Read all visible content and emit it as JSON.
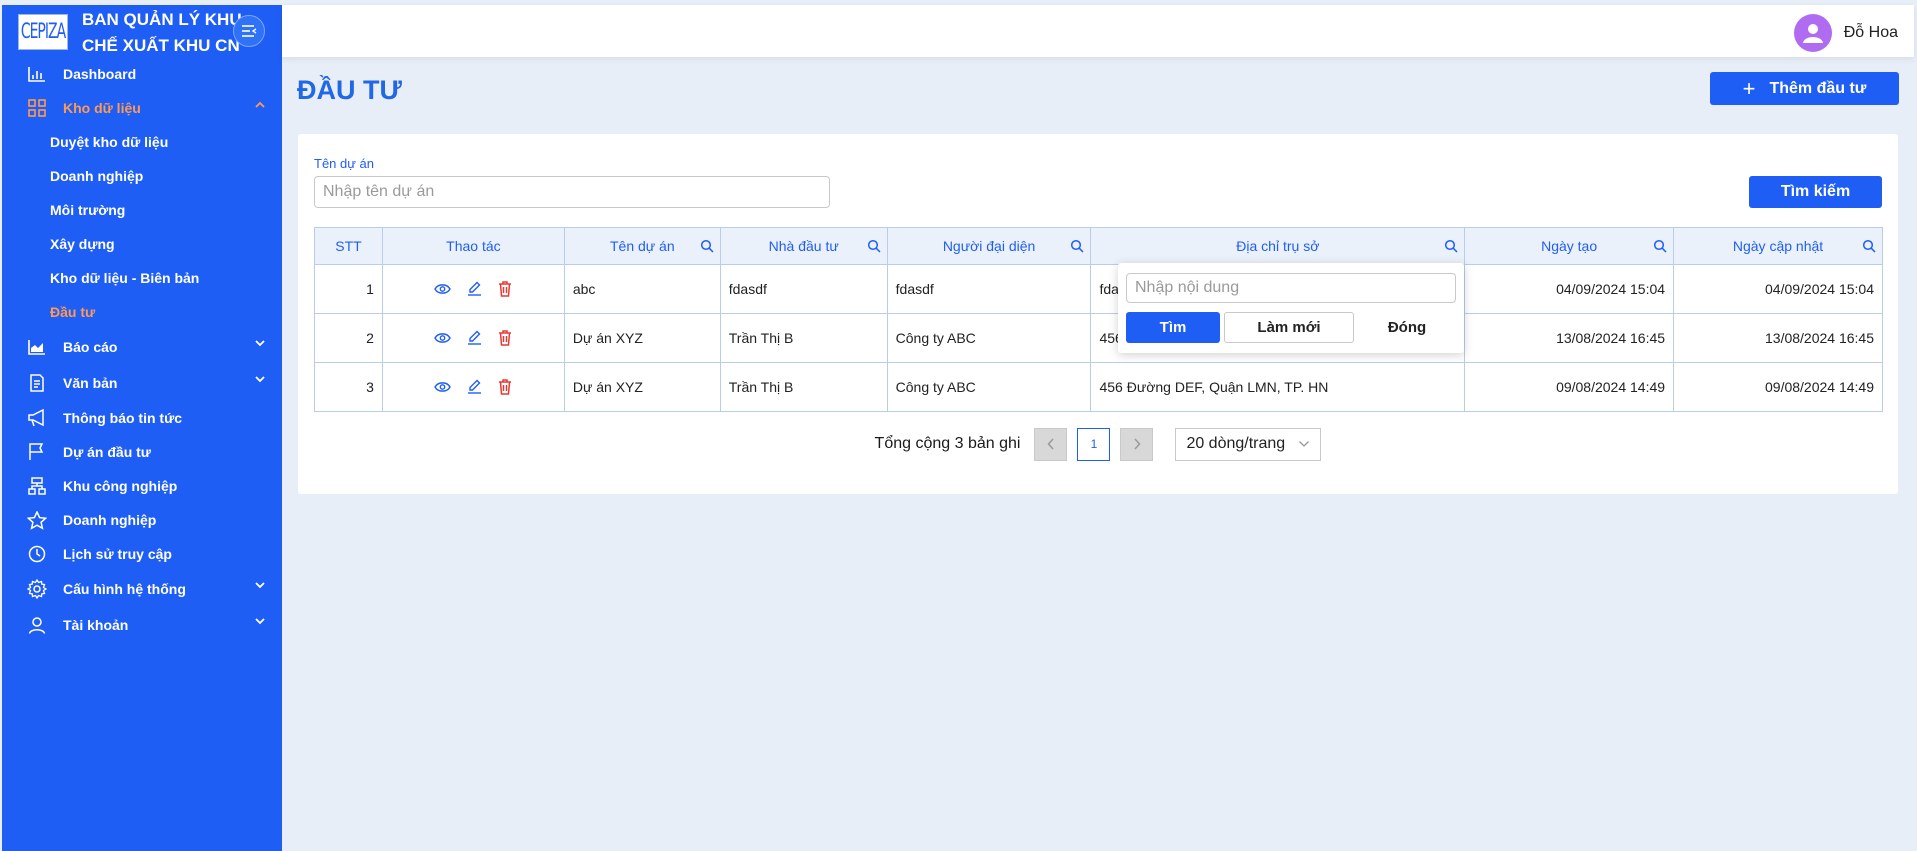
{
  "sidebar": {
    "logo_text": "CEPIZA",
    "org_name_line1": "BAN QUẢN LÝ KHU",
    "org_name_line2": "CHẾ XUẤT KHU CN",
    "items": [
      {
        "label": "Dashboard",
        "icon": "chart-bar-icon"
      },
      {
        "label": "Kho dữ liệu",
        "icon": "grid-icon"
      },
      {
        "label": "Báo cáo",
        "icon": "area-chart-icon"
      },
      {
        "label": "Văn bản",
        "icon": "document-icon"
      },
      {
        "label": "Thông báo tin tức",
        "icon": "megaphone-icon"
      },
      {
        "label": "Dự án đầu tư",
        "icon": "flag-icon"
      },
      {
        "label": "Khu công nghiệp",
        "icon": "sitemap-icon"
      },
      {
        "label": "Doanh nghiệp",
        "icon": "star-icon"
      },
      {
        "label": "Lịch sử truy cập",
        "icon": "clock-icon"
      },
      {
        "label": "Cấu hình hệ thống",
        "icon": "gear-icon"
      },
      {
        "label": "Tài khoản",
        "icon": "user-icon"
      }
    ],
    "subitems": [
      {
        "label": "Duyệt kho dữ liệu"
      },
      {
        "label": "Doanh nghiệp"
      },
      {
        "label": "Môi trường"
      },
      {
        "label": "Xây dựng"
      },
      {
        "label": "Kho dữ liệu - Biên bản"
      },
      {
        "label": "Đầu tư"
      }
    ],
    "accent_color": "#1f5ef5",
    "active_color": "#ff9a52"
  },
  "header": {
    "user_name": "Đỗ Hoa",
    "avatar_color": "#b06cf0"
  },
  "page": {
    "title": "ĐẦU TƯ",
    "add_button": "Thêm đầu tư"
  },
  "filter": {
    "label": "Tên dự án",
    "placeholder": "Nhập tên dự án",
    "search_button": "Tìm kiếm"
  },
  "table": {
    "headers": [
      "STT",
      "Thao tác",
      "Tên dự án",
      "Nhà đầu tư",
      "Người đại diện",
      "Địa chỉ trụ sở",
      "Ngày tạo",
      "Ngày cập nhật"
    ],
    "rows": [
      {
        "stt": "1",
        "name": "abc",
        "investor": "fdasdf",
        "rep": "fdasdf",
        "address": "fda",
        "created": "04/09/2024 15:04",
        "updated": "04/09/2024 15:04"
      },
      {
        "stt": "2",
        "name": "Dự án XYZ",
        "investor": "Trần Thị B",
        "rep": "Công ty ABC",
        "address": "456",
        "created": "13/08/2024 16:45",
        "updated": "13/08/2024 16:45"
      },
      {
        "stt": "3",
        "name": "Dự án XYZ",
        "investor": "Trần Thị B",
        "rep": "Công ty ABC",
        "address": "456 Đường DEF, Quận LMN, TP. HN",
        "created": "09/08/2024 14:49",
        "updated": "09/08/2024 14:49"
      }
    ]
  },
  "pagination": {
    "total_text": "Tổng cộng 3 bản ghi",
    "current_page": "1",
    "page_size": "20 dòng/trang"
  },
  "popup": {
    "placeholder": "Nhập nội dung",
    "find": "Tìm",
    "reset": "Làm mới",
    "close": "Đóng"
  }
}
